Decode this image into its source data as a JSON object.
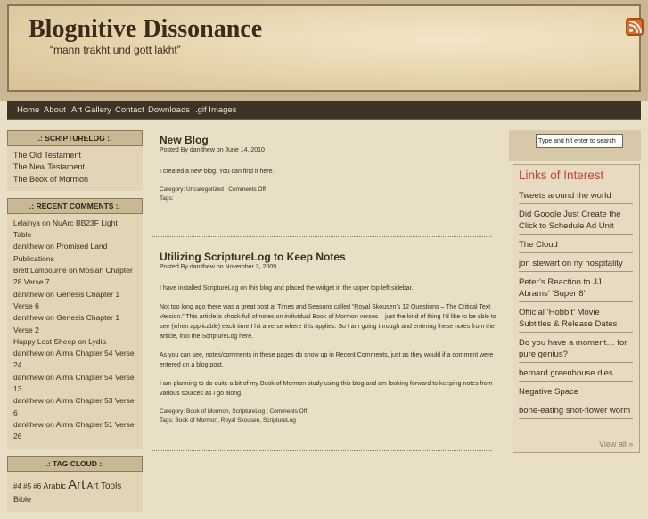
{
  "header": {
    "title": "Blognitive Dissonance",
    "tagline": "“mann trakht und gott lakht”",
    "rss_icon": "rss-icon"
  },
  "nav": [
    "Home",
    "About",
    "Art Gallery",
    "Contact",
    "Downloads",
    ".gif Images"
  ],
  "sidebar_left": {
    "scripturelog": {
      "heading": ".: SCRIPTURELOG :.",
      "items": [
        "The Old Testament",
        "The New Testament",
        "The Book of Mormon"
      ]
    },
    "recent_comments": {
      "heading": ".: RECENT COMMENTS :.",
      "items": [
        {
          "author": "Lelainya",
          "on": " on ",
          "post": "NuArc BB23F Light Table"
        },
        {
          "author": "danithew",
          "on": " on ",
          "post": "Promised Land Publications"
        },
        {
          "author": "Brett Lambourne",
          "on": " on ",
          "post": "Mosiah Chapter 28 Verse 7"
        },
        {
          "author": "danithew",
          "on": " on ",
          "post": "Genesis Chapter 1 Verse 6"
        },
        {
          "author": "danithew",
          "on": " on ",
          "post": "Genesis Chapter 1 Verse 2"
        },
        {
          "author": "Happy Lost Sheep",
          "on": " on ",
          "post": "Lydia"
        },
        {
          "author": "danithew",
          "on": " on ",
          "post": "Alma Chapter 54 Verse 24"
        },
        {
          "author": "danithew",
          "on": " on ",
          "post": "Alma Chapter 54 Verse 13"
        },
        {
          "author": "danithew",
          "on": " on ",
          "post": "Alma Chapter 53 Verse 6"
        },
        {
          "author": "danithew",
          "on": " on ",
          "post": "Alma Chapter 51 Verse 26"
        }
      ]
    },
    "tag_cloud": {
      "heading": ".: TAG CLOUD :.",
      "tags": [
        "#4",
        "#5",
        "#6",
        "Arabic",
        "Art",
        "Art Tools",
        "Bible"
      ]
    }
  },
  "posts": [
    {
      "title": "New Blog",
      "meta": "Posted By danithew on June 14, 2010",
      "body": [
        "I created a new blog.  You can find it here."
      ],
      "category": "Category: Uncategorized | Comments Off",
      "tags": "Tags:"
    },
    {
      "title": "Utilizing ScriptureLog to Keep Notes",
      "meta": "Posted By danithew on November 3, 2009",
      "body": [
        "I have installed ScriptureLog on this blog and placed the widget in the upper top left sidebar.",
        "Not too long ago there was a great post at Times and Seasons called “Royal Skousen’s 12 Questions – The Critical Text Version.”  This article is chock-full of notes on individual Book of Mormon verses – just the kind of thing I’d like to be able to see (when applicable) each time I hit a verse where this applies.  So I am going through and entering these notes from the article, into the ScriptureLog here.",
        "As you can see, notes/comments in these pages do show up in Recent Comments, just as they would if a comment were entered on a blog post.",
        "I am planning to do quite a bit of my Book of Mormon study using this blog and am looking forward to keeping notes from various sources as I go along."
      ],
      "category": "Category: Book of Mormon, ScriptureLog | Comments Off",
      "tags": "Tags: Book of Mormon, Royal Skousen, ScriptureLog"
    }
  ],
  "sidebar_right": {
    "search_placeholder": "Type and hit enter to search",
    "links_title": "Links of Interest",
    "links": [
      "Tweets around the world",
      "Did Google Just Create the Click to Schedule Ad Unit",
      "The Cloud",
      "jon stewart on ny hospitality",
      "Peter’s Reaction to JJ Abrams’ ‘Super 8’",
      "Official ‘Hobbit’ Movie Subtitles & Release Dates",
      "Do you have a moment… for pure genius?",
      "bernard greenhouse dies",
      "Negative Space",
      "bone-eating snot-flower worm"
    ],
    "view_all": "View all »"
  }
}
